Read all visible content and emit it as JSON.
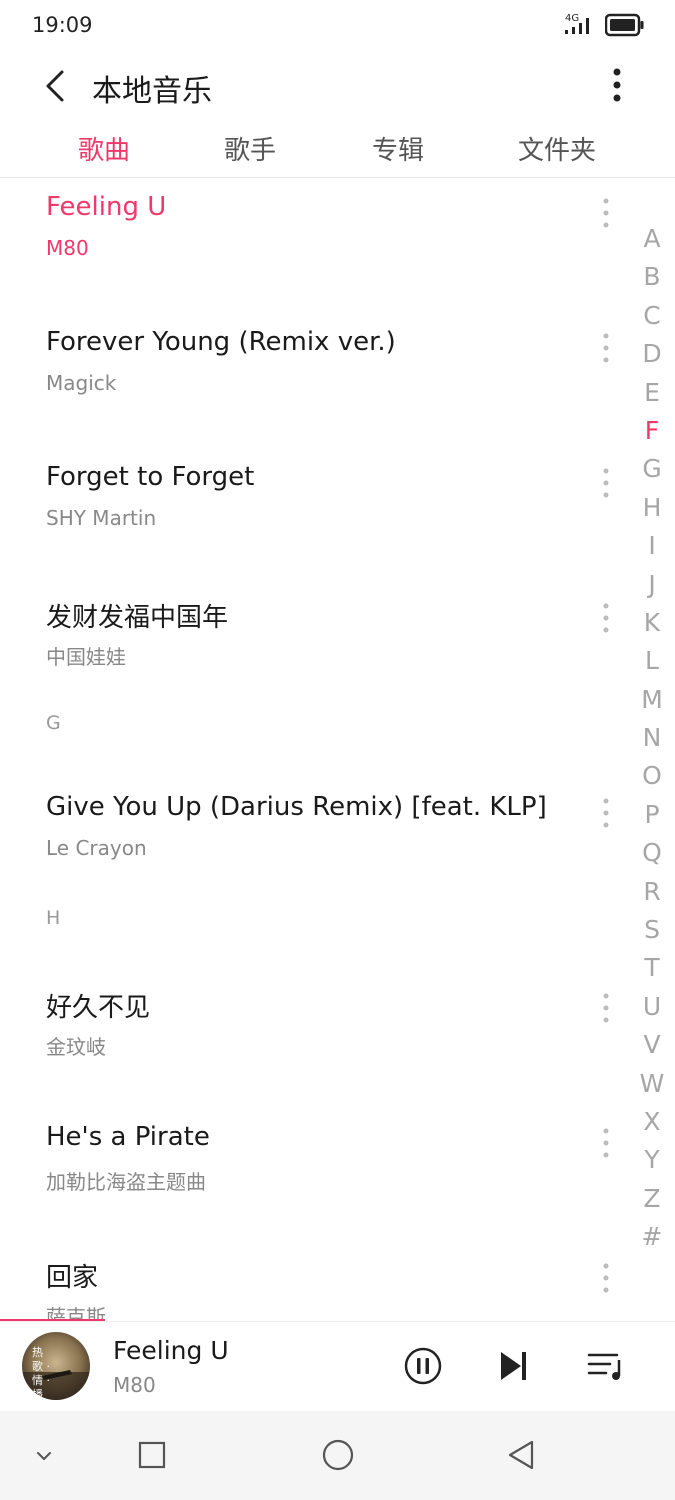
{
  "status": {
    "time": "19:09",
    "network": "4G"
  },
  "header": {
    "title": "本地音乐"
  },
  "tabs": [
    {
      "label": "歌曲",
      "active": true
    },
    {
      "label": "歌手",
      "active": false
    },
    {
      "label": "专辑",
      "active": false
    },
    {
      "label": "文件夹",
      "active": false
    }
  ],
  "songs": [
    {
      "title": "Feeling U",
      "artist": "M80",
      "playing": true
    },
    {
      "title": "Forever Young (Remix ver.)",
      "artist": "Magick"
    },
    {
      "title": "Forget to Forget",
      "artist": "SHY Martin"
    },
    {
      "title": "发财发福中国年",
      "artist": "中国娃娃"
    },
    {
      "section": "G"
    },
    {
      "title": "Give You Up (Darius Remix) [feat. KLP]",
      "artist": "Le Crayon"
    },
    {
      "section": "H"
    },
    {
      "title": "好久不见",
      "artist": "金玟岐"
    },
    {
      "title": "He's a Pirate",
      "artist": "加勒比海盗主题曲"
    },
    {
      "title": "回家",
      "artist": "萨克斯"
    }
  ],
  "index": {
    "letters": [
      "A",
      "B",
      "C",
      "D",
      "E",
      "F",
      "G",
      "H",
      "I",
      "J",
      "K",
      "L",
      "M",
      "N",
      "O",
      "P",
      "Q",
      "R",
      "S",
      "T",
      "U",
      "V",
      "W",
      "X",
      "Y",
      "Z",
      "#"
    ],
    "active": "F"
  },
  "player": {
    "title": "Feeling U",
    "artist": "M80",
    "album_text": "热歌 · 情 · 播",
    "progress": 0.156
  },
  "colors": {
    "accent": "#f0386b",
    "text": "#1a1a1a",
    "secondary": "#888888",
    "index": "#a6a6a6"
  },
  "icons": {
    "back": "chevron-left-icon",
    "more": "more-vertical-icon",
    "pause": "pause-circle-icon",
    "next": "skip-next-icon",
    "playlist": "playlist-icon",
    "nav_collapse": "chevron-down-icon",
    "nav_recent": "square-icon",
    "nav_home": "circle-icon",
    "nav_back": "triangle-back-icon"
  }
}
